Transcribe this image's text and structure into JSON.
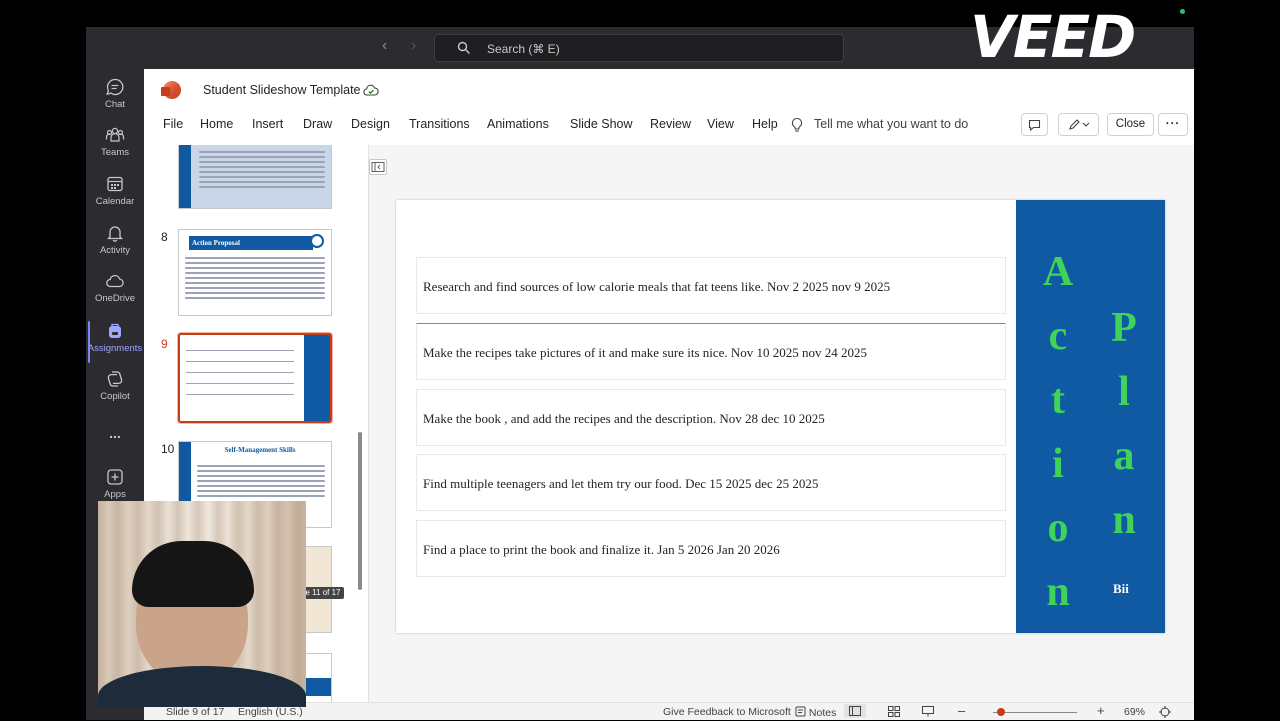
{
  "titlebar": {
    "search_placeholder": "Search (⌘ E)",
    "watermark": "VEED"
  },
  "rail": [
    {
      "label": "Chat",
      "icon": "chat-icon"
    },
    {
      "label": "Teams",
      "icon": "teams-icon"
    },
    {
      "label": "Calendar",
      "icon": "calendar-icon"
    },
    {
      "label": "Activity",
      "icon": "bell-icon"
    },
    {
      "label": "OneDrive",
      "icon": "cloud-icon"
    },
    {
      "label": "Assignments",
      "icon": "backpack-icon",
      "active": true
    },
    {
      "label": "Copilot",
      "icon": "copilot-icon"
    },
    {
      "label": "...",
      "icon": "more-icon"
    },
    {
      "label": "Apps",
      "icon": "plus-box-icon"
    }
  ],
  "document": {
    "title": "Student Slideshow Template"
  },
  "ribbon": {
    "menu": [
      "File",
      "Home",
      "Insert",
      "Draw",
      "Design",
      "Transitions",
      "Animations",
      "Slide Show",
      "Review",
      "View",
      "Help"
    ],
    "tell_me": "Tell me what you want to do",
    "close": "Close",
    "more": "···"
  },
  "thumbnails": {
    "items": [
      {
        "num": "",
        "title": ""
      },
      {
        "num": "8",
        "title": "Action Proposal"
      },
      {
        "num": "9",
        "title": "",
        "selected": true
      },
      {
        "num": "10",
        "title": "Self-Management Skills"
      }
    ],
    "tooltip": "e 11 of 17"
  },
  "slide": {
    "rows": [
      "Research and find sources of low calorie meals that fat teens like. Nov 2 2025 nov 9 2025",
      "Make the recipes take pictures of it and make sure its nice. Nov 10 2025 nov 24 2025",
      "Make the book , and add the recipes and the description. Nov 28 dec 10 2025",
      "Find multiple teenagers and let them try our food. Dec 15  2025 dec 25 2025",
      "Find a place to print the book and finalize it. Jan 5 2026 Jan 20 2026"
    ],
    "vertical_left": [
      "A",
      "c",
      "t",
      "i",
      "o",
      "n"
    ],
    "vertical_right": [
      "P",
      "l",
      "a",
      "n"
    ],
    "band_label": "Bii",
    "band_color": "#0f5aa3",
    "letter_color": "#3fd35a"
  },
  "status": {
    "slide_info": "Slide 9 of 17",
    "language": "English (U.S.)",
    "feedback": "Give Feedback to Microsoft",
    "notes": "Notes",
    "zoom_minus": "–",
    "zoom_plus": "+",
    "zoom": "69%"
  }
}
